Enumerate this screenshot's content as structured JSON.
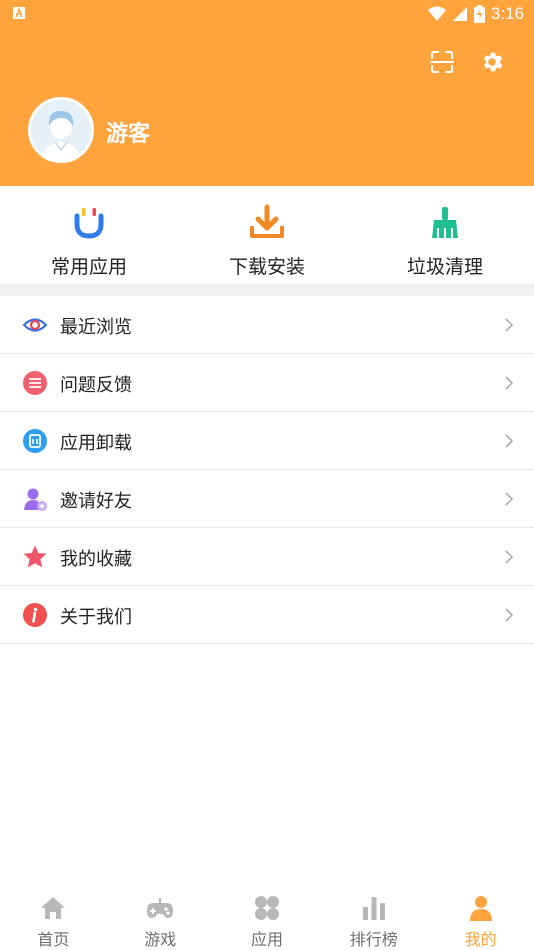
{
  "status_bar": {
    "time": "3:16"
  },
  "header": {
    "username": "游客",
    "scan_icon": "scan-icon",
    "settings_icon": "gear-icon",
    "background": "#ffa33d"
  },
  "quick_actions": [
    {
      "label": "常用应用",
      "icon": "magnet-icon"
    },
    {
      "label": "下载安装",
      "icon": "download-icon"
    },
    {
      "label": "垃圾清理",
      "icon": "broom-icon"
    }
  ],
  "menu": [
    {
      "label": "最近浏览",
      "icon": "eye-icon"
    },
    {
      "label": "问题反馈",
      "icon": "feedback-icon"
    },
    {
      "label": "应用卸载",
      "icon": "uninstall-icon"
    },
    {
      "label": "邀请好友",
      "icon": "invite-user-icon"
    },
    {
      "label": "我的收藏",
      "icon": "star-icon"
    },
    {
      "label": "关于我们",
      "icon": "info-icon"
    }
  ],
  "tabbar": [
    {
      "label": "首页",
      "icon": "home-icon"
    },
    {
      "label": "游戏",
      "icon": "gamepad-icon"
    },
    {
      "label": "应用",
      "icon": "apps-icon"
    },
    {
      "label": "排行榜",
      "icon": "bar-chart-icon"
    },
    {
      "label": "我的",
      "icon": "user-icon",
      "active": true
    }
  ],
  "colors": {
    "accent": "#ffa33d",
    "inactive_tab": "#b8b8b8"
  }
}
